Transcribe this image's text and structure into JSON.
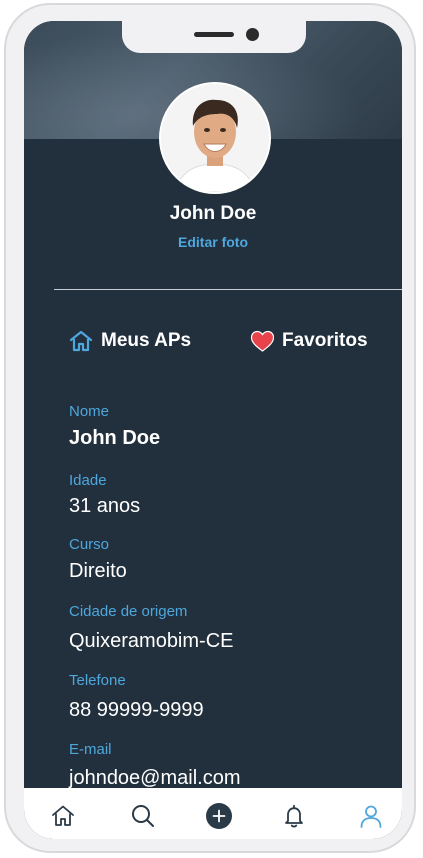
{
  "profile": {
    "name": "John Doe",
    "edit_photo_label": "Editar foto"
  },
  "tabs": {
    "my_aps_label": "Meus APs",
    "favorites_label": "Favoritos"
  },
  "fields": [
    {
      "label": "Nome",
      "value": "John Doe"
    },
    {
      "label": "Idade",
      "value": "31 anos"
    },
    {
      "label": "Curso",
      "value": "Direito"
    },
    {
      "label": "Cidade de origem",
      "value": "Quixeramobim-CE"
    },
    {
      "label": "Telefone",
      "value": "88 99999-9999"
    },
    {
      "label": "E-mail",
      "value": "johndoe@mail.com"
    }
  ],
  "bottom_nav": [
    "home-icon",
    "search-icon",
    "add-icon",
    "bell-icon",
    "user-icon"
  ],
  "colors": {
    "background": "#22303d",
    "accent": "#4ea7dd",
    "favorite": "#e8424b",
    "nav_active": "#4ea7dd",
    "nav_inactive": "#2b3a47"
  }
}
